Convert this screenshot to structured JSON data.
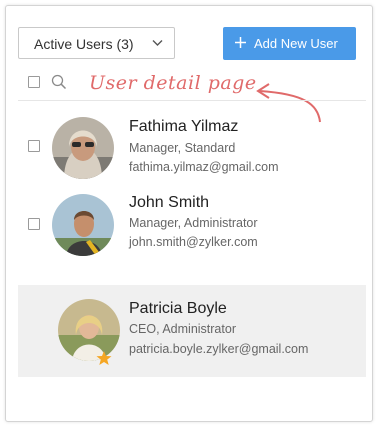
{
  "filter": {
    "label": "Active Users (3)"
  },
  "add_button": {
    "label": "Add New User"
  },
  "annotation": "User detail page",
  "users": [
    {
      "name": "Fathima Yilmaz",
      "role": "Manager, Standard",
      "email": "fathima.yilmaz@gmail.com"
    },
    {
      "name": "John Smith",
      "role": "Manager, Administrator",
      "email": "john.smith@zylker.com"
    },
    {
      "name": "Patricia Boyle",
      "role": "CEO, Administrator",
      "email": "patricia.boyle.zylker@gmail.com"
    }
  ],
  "colors": {
    "accent": "#4a9ae8",
    "annotation": "#e06a6a",
    "star": "#f5a623",
    "selected_row": "#f0f0f0"
  },
  "icons": [
    "chevron-down-icon",
    "plus-icon",
    "search-icon",
    "curved-arrow-icon",
    "star-icon"
  ]
}
